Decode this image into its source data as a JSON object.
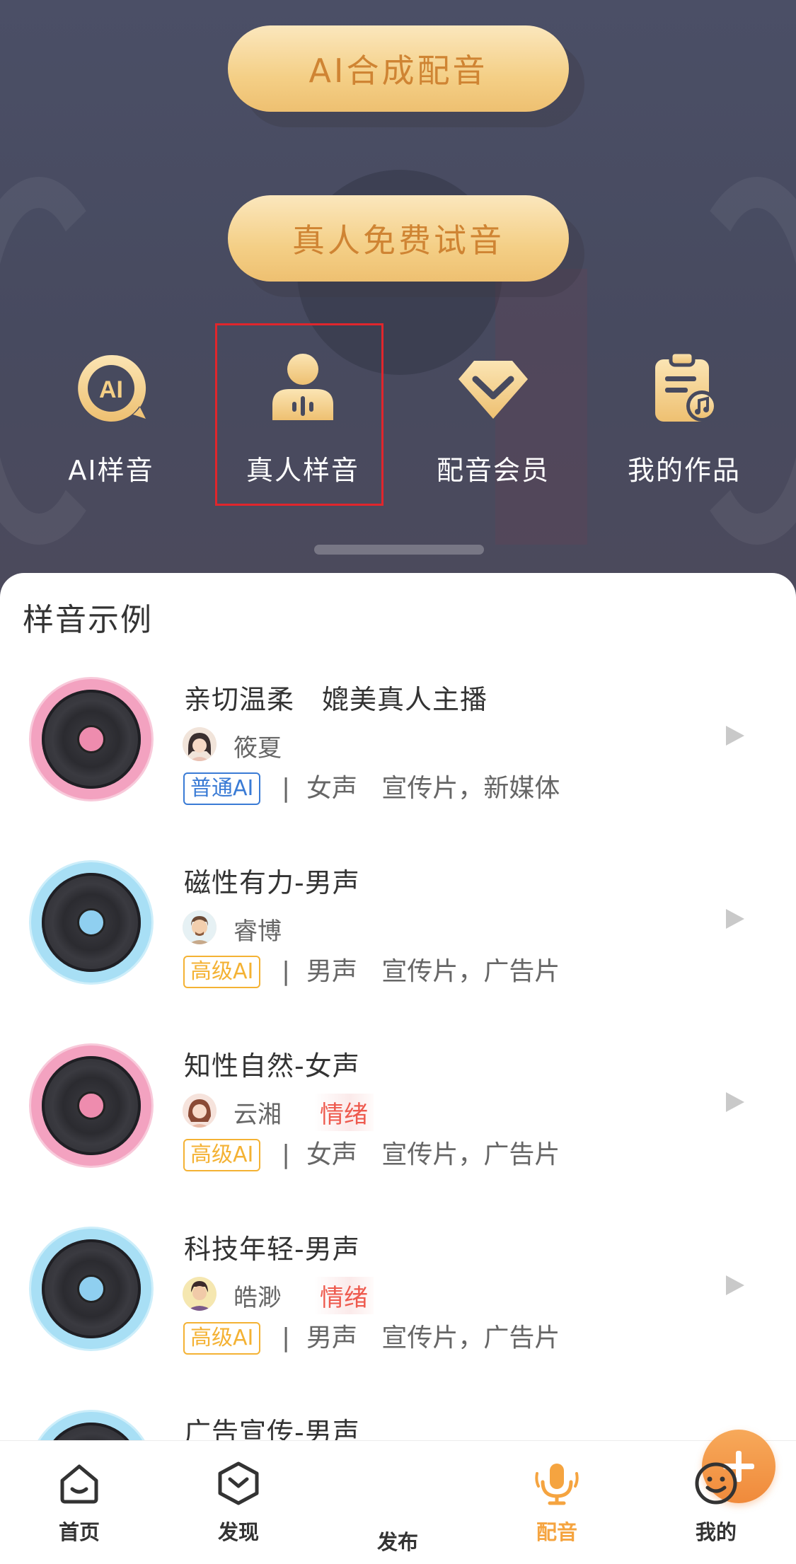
{
  "hero": {
    "primary_button": "AI合成配音",
    "secondary_button": "真人免费试音",
    "quick_actions": [
      {
        "label": "AI样音",
        "icon": "ai-bubble-icon"
      },
      {
        "label": "真人样音",
        "icon": "person-voice-icon"
      },
      {
        "label": "配音会员",
        "icon": "diamond-icon"
      },
      {
        "label": "我的作品",
        "icon": "clipboard-music-icon"
      }
    ]
  },
  "samples": {
    "title": "样音示例",
    "items": [
      {
        "name": "亲切温柔　媲美真人主播",
        "voice": "筱夏",
        "emotion": "",
        "tag": "普通AI",
        "tag_type": "normal",
        "gender": "女声",
        "uses": "宣传片，新媒体",
        "disc": "pink"
      },
      {
        "name": "磁性有力-男声",
        "voice": "睿博",
        "emotion": "",
        "tag": "高级AI",
        "tag_type": "advanced",
        "gender": "男声",
        "uses": "宣传片，广告片",
        "disc": "blue"
      },
      {
        "name": "知性自然-女声",
        "voice": "云湘",
        "emotion": "情绪",
        "tag": "高级AI",
        "tag_type": "advanced",
        "gender": "女声",
        "uses": "宣传片，广告片",
        "disc": "pink"
      },
      {
        "name": "科技年轻-男声",
        "voice": "皓渺",
        "emotion": "情绪",
        "tag": "高级AI",
        "tag_type": "advanced",
        "gender": "男声",
        "uses": "宣传片，广告片",
        "disc": "blue"
      },
      {
        "name": "广告宣传-男声",
        "voice": "",
        "emotion": "",
        "tag": "",
        "tag_type": "",
        "gender": "",
        "uses": "",
        "disc": "blue"
      }
    ]
  },
  "nav": {
    "home": "首页",
    "discover": "发现",
    "publish": "发布",
    "dubbing": "配音",
    "mine": "我的"
  },
  "colors": {
    "accent": "#f5a440",
    "gold_text": "#cf8433",
    "highlight": "#e0262c"
  }
}
